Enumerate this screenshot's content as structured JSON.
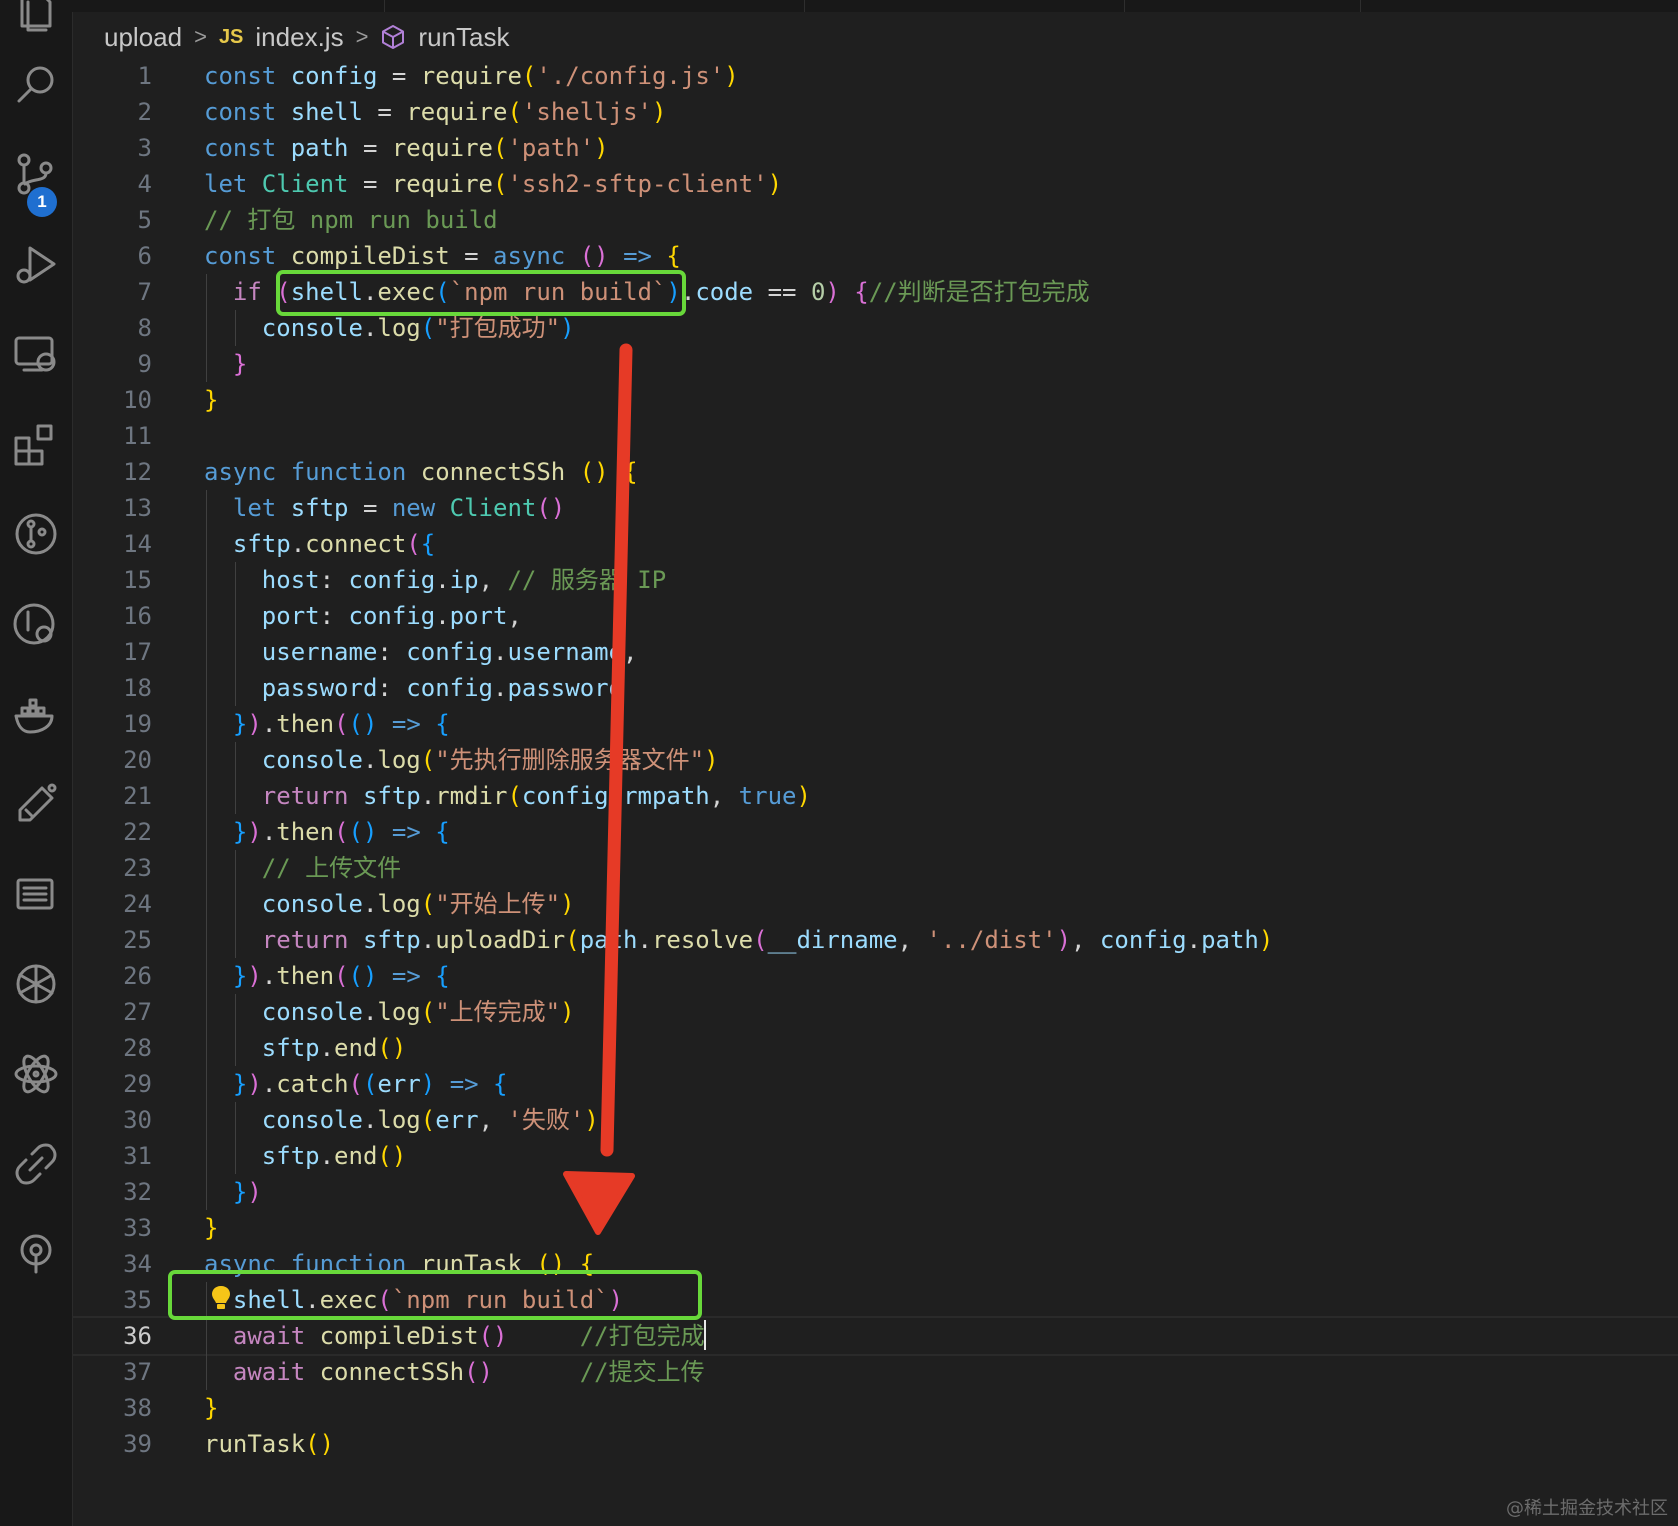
{
  "breadcrumb": {
    "folder": "upload",
    "file_badge": "JS",
    "file": "index.js",
    "symbol": "runTask"
  },
  "activity_bar": {
    "source_control_badge": "1",
    "icons": [
      "files-icon",
      "search-icon",
      "source-control-icon",
      "run-debug-icon",
      "remote-explorer-icon",
      "extensions-icon",
      "git-graph-icon",
      "git-history-icon",
      "docker-icon",
      "testing-icon",
      "outline-icon",
      "chatgpt-icon",
      "react-icon",
      "link-icon",
      "gitlens-icon"
    ]
  },
  "editor": {
    "active_line": 36,
    "lines": [
      {
        "n": "1",
        "t": [
          [
            "kw",
            "const "
          ],
          [
            "var",
            "config "
          ],
          [
            "op",
            "= "
          ],
          [
            "fn",
            "require"
          ],
          [
            "b1",
            "("
          ],
          [
            "str",
            "'./config.js'"
          ],
          [
            "b1",
            ")"
          ]
        ]
      },
      {
        "n": "2",
        "t": [
          [
            "kw",
            "const "
          ],
          [
            "var",
            "shell "
          ],
          [
            "op",
            "= "
          ],
          [
            "fn",
            "require"
          ],
          [
            "b1",
            "("
          ],
          [
            "str",
            "'shelljs'"
          ],
          [
            "b1",
            ")"
          ]
        ]
      },
      {
        "n": "3",
        "t": [
          [
            "kw",
            "const "
          ],
          [
            "var",
            "path "
          ],
          [
            "op",
            "= "
          ],
          [
            "fn",
            "require"
          ],
          [
            "b1",
            "("
          ],
          [
            "str",
            "'path'"
          ],
          [
            "b1",
            ")"
          ]
        ]
      },
      {
        "n": "4",
        "t": [
          [
            "kw",
            "let "
          ],
          [
            "cls",
            "Client "
          ],
          [
            "op",
            "= "
          ],
          [
            "fn",
            "require"
          ],
          [
            "b1",
            "("
          ],
          [
            "str",
            "'ssh2-sftp-client'"
          ],
          [
            "b1",
            ")"
          ]
        ]
      },
      {
        "n": "5",
        "t": [
          [
            "cmt",
            "// 打包 npm run build"
          ]
        ]
      },
      {
        "n": "6",
        "t": [
          [
            "kw",
            "const "
          ],
          [
            "fn",
            "compileDist "
          ],
          [
            "op",
            "= "
          ],
          [
            "kw",
            "async "
          ],
          [
            "b2",
            "() "
          ],
          [
            "kw",
            "=> "
          ],
          [
            "b1",
            "{"
          ]
        ]
      },
      {
        "n": "7",
        "t": [
          [
            "op",
            "  "
          ],
          [
            "ctrl",
            "if "
          ],
          [
            "b2",
            "("
          ],
          [
            "var",
            "shell"
          ],
          [
            "op",
            "."
          ],
          [
            "fn",
            "exec"
          ],
          [
            "b3",
            "("
          ],
          [
            "str",
            "`npm run build`"
          ],
          [
            "b3",
            ")"
          ],
          [
            "op",
            "."
          ],
          [
            "var",
            "code "
          ],
          [
            "op",
            "== "
          ],
          [
            "num",
            "0"
          ],
          [
            "b2",
            ") "
          ],
          [
            "b2",
            "{"
          ],
          [
            "cmt",
            "//判断是否打包完成"
          ]
        ]
      },
      {
        "n": "8",
        "t": [
          [
            "op",
            "    "
          ],
          [
            "var",
            "console"
          ],
          [
            "op",
            "."
          ],
          [
            "fn",
            "log"
          ],
          [
            "b3",
            "("
          ],
          [
            "str",
            "\"打包成功\""
          ],
          [
            "b3",
            ")"
          ]
        ]
      },
      {
        "n": "9",
        "t": [
          [
            "op",
            "  "
          ],
          [
            "b2",
            "}"
          ]
        ]
      },
      {
        "n": "10",
        "t": [
          [
            "b1",
            "}"
          ]
        ]
      },
      {
        "n": "11",
        "t": []
      },
      {
        "n": "12",
        "t": [
          [
            "kw",
            "async "
          ],
          [
            "kw",
            "function "
          ],
          [
            "fn",
            "connectSSh "
          ],
          [
            "b1",
            "() "
          ],
          [
            "b1",
            "{"
          ]
        ]
      },
      {
        "n": "13",
        "t": [
          [
            "op",
            "  "
          ],
          [
            "kw",
            "let "
          ],
          [
            "var",
            "sftp "
          ],
          [
            "op",
            "= "
          ],
          [
            "kw",
            "new "
          ],
          [
            "cls",
            "Client"
          ],
          [
            "b2",
            "()"
          ]
        ]
      },
      {
        "n": "14",
        "t": [
          [
            "op",
            "  "
          ],
          [
            "var",
            "sftp"
          ],
          [
            "op",
            "."
          ],
          [
            "fn",
            "connect"
          ],
          [
            "b2",
            "("
          ],
          [
            "b3",
            "{"
          ]
        ]
      },
      {
        "n": "15",
        "t": [
          [
            "op",
            "    "
          ],
          [
            "var",
            "host"
          ],
          [
            "op",
            ": "
          ],
          [
            "var",
            "config"
          ],
          [
            "op",
            "."
          ],
          [
            "var",
            "ip"
          ],
          [
            "op",
            ", "
          ],
          [
            "cmt",
            "// 服务器 IP"
          ]
        ]
      },
      {
        "n": "16",
        "t": [
          [
            "op",
            "    "
          ],
          [
            "var",
            "port"
          ],
          [
            "op",
            ": "
          ],
          [
            "var",
            "config"
          ],
          [
            "op",
            "."
          ],
          [
            "var",
            "port"
          ],
          [
            "op",
            ","
          ]
        ]
      },
      {
        "n": "17",
        "t": [
          [
            "op",
            "    "
          ],
          [
            "var",
            "username"
          ],
          [
            "op",
            ": "
          ],
          [
            "var",
            "config"
          ],
          [
            "op",
            "."
          ],
          [
            "var",
            "username"
          ],
          [
            "op",
            ","
          ]
        ]
      },
      {
        "n": "18",
        "t": [
          [
            "op",
            "    "
          ],
          [
            "var",
            "password"
          ],
          [
            "op",
            ": "
          ],
          [
            "var",
            "config"
          ],
          [
            "op",
            "."
          ],
          [
            "var",
            "password"
          ]
        ]
      },
      {
        "n": "19",
        "t": [
          [
            "op",
            "  "
          ],
          [
            "b3",
            "}"
          ],
          [
            "b2",
            ")"
          ],
          [
            "op",
            "."
          ],
          [
            "fn",
            "then"
          ],
          [
            "b2",
            "("
          ],
          [
            "b3",
            "() "
          ],
          [
            "kw",
            "=> "
          ],
          [
            "b3",
            "{"
          ]
        ]
      },
      {
        "n": "20",
        "t": [
          [
            "op",
            "    "
          ],
          [
            "var",
            "console"
          ],
          [
            "op",
            "."
          ],
          [
            "fn",
            "log"
          ],
          [
            "b1",
            "("
          ],
          [
            "str",
            "\"先执行删除服务器文件\""
          ],
          [
            "b1",
            ")"
          ]
        ]
      },
      {
        "n": "21",
        "t": [
          [
            "op",
            "    "
          ],
          [
            "ctrl",
            "return "
          ],
          [
            "var",
            "sftp"
          ],
          [
            "op",
            "."
          ],
          [
            "fn",
            "rmdir"
          ],
          [
            "b1",
            "("
          ],
          [
            "var",
            "config"
          ],
          [
            "op",
            "."
          ],
          [
            "var",
            "rmpath"
          ],
          [
            "op",
            ", "
          ],
          [
            "kw",
            "true"
          ],
          [
            "b1",
            ")"
          ]
        ]
      },
      {
        "n": "22",
        "t": [
          [
            "op",
            "  "
          ],
          [
            "b3",
            "}"
          ],
          [
            "b2",
            ")"
          ],
          [
            "op",
            "."
          ],
          [
            "fn",
            "then"
          ],
          [
            "b2",
            "("
          ],
          [
            "b3",
            "() "
          ],
          [
            "kw",
            "=> "
          ],
          [
            "b3",
            "{"
          ]
        ]
      },
      {
        "n": "23",
        "t": [
          [
            "op",
            "    "
          ],
          [
            "cmt",
            "// 上传文件"
          ]
        ]
      },
      {
        "n": "24",
        "t": [
          [
            "op",
            "    "
          ],
          [
            "var",
            "console"
          ],
          [
            "op",
            "."
          ],
          [
            "fn",
            "log"
          ],
          [
            "b1",
            "("
          ],
          [
            "str",
            "\"开始上传\""
          ],
          [
            "b1",
            ")"
          ]
        ]
      },
      {
        "n": "25",
        "t": [
          [
            "op",
            "    "
          ],
          [
            "ctrl",
            "return "
          ],
          [
            "var",
            "sftp"
          ],
          [
            "op",
            "."
          ],
          [
            "fn",
            "uploadDir"
          ],
          [
            "b1",
            "("
          ],
          [
            "var",
            "path"
          ],
          [
            "op",
            "."
          ],
          [
            "fn",
            "resolve"
          ],
          [
            "b2",
            "("
          ],
          [
            "var",
            "__dirname"
          ],
          [
            "op",
            ", "
          ],
          [
            "str",
            "'../dist'"
          ],
          [
            "b2",
            ")"
          ],
          [
            "op",
            ", "
          ],
          [
            "var",
            "config"
          ],
          [
            "op",
            "."
          ],
          [
            "var",
            "path"
          ],
          [
            "b1",
            ")"
          ]
        ]
      },
      {
        "n": "26",
        "t": [
          [
            "op",
            "  "
          ],
          [
            "b3",
            "}"
          ],
          [
            "b2",
            ")"
          ],
          [
            "op",
            "."
          ],
          [
            "fn",
            "then"
          ],
          [
            "b2",
            "("
          ],
          [
            "b3",
            "() "
          ],
          [
            "kw",
            "=> "
          ],
          [
            "b3",
            "{"
          ]
        ]
      },
      {
        "n": "27",
        "t": [
          [
            "op",
            "    "
          ],
          [
            "var",
            "console"
          ],
          [
            "op",
            "."
          ],
          [
            "fn",
            "log"
          ],
          [
            "b1",
            "("
          ],
          [
            "str",
            "\"上传完成\""
          ],
          [
            "b1",
            ")"
          ]
        ]
      },
      {
        "n": "28",
        "t": [
          [
            "op",
            "    "
          ],
          [
            "var",
            "sftp"
          ],
          [
            "op",
            "."
          ],
          [
            "fn",
            "end"
          ],
          [
            "b1",
            "()"
          ]
        ]
      },
      {
        "n": "29",
        "t": [
          [
            "op",
            "  "
          ],
          [
            "b3",
            "}"
          ],
          [
            "b2",
            ")"
          ],
          [
            "op",
            "."
          ],
          [
            "fn",
            "catch"
          ],
          [
            "b2",
            "("
          ],
          [
            "b3",
            "("
          ],
          [
            "var",
            "err"
          ],
          [
            "b3",
            ") "
          ],
          [
            "kw",
            "=> "
          ],
          [
            "b3",
            "{"
          ]
        ]
      },
      {
        "n": "30",
        "t": [
          [
            "op",
            "    "
          ],
          [
            "var",
            "console"
          ],
          [
            "op",
            "."
          ],
          [
            "fn",
            "log"
          ],
          [
            "b1",
            "("
          ],
          [
            "var",
            "err"
          ],
          [
            "op",
            ", "
          ],
          [
            "str",
            "'失败'"
          ],
          [
            "b1",
            ")"
          ]
        ]
      },
      {
        "n": "31",
        "t": [
          [
            "op",
            "    "
          ],
          [
            "var",
            "sftp"
          ],
          [
            "op",
            "."
          ],
          [
            "fn",
            "end"
          ],
          [
            "b1",
            "()"
          ]
        ]
      },
      {
        "n": "32",
        "t": [
          [
            "op",
            "  "
          ],
          [
            "b3",
            "}"
          ],
          [
            "b2",
            ")"
          ]
        ]
      },
      {
        "n": "33",
        "t": [
          [
            "b1",
            "}"
          ]
        ]
      },
      {
        "n": "34",
        "t": [
          [
            "kw",
            "async "
          ],
          [
            "kw",
            "function "
          ],
          [
            "fn",
            "runTask "
          ],
          [
            "b1",
            "() "
          ],
          [
            "b1",
            "{"
          ]
        ]
      },
      {
        "n": "35",
        "t": [
          [
            "op",
            "  "
          ],
          [
            "var",
            "shell"
          ],
          [
            "op",
            "."
          ],
          [
            "fn",
            "exec"
          ],
          [
            "b2",
            "("
          ],
          [
            "str",
            "`npm run build`"
          ],
          [
            "b2",
            ")"
          ]
        ]
      },
      {
        "n": "36",
        "t": [
          [
            "op",
            "  "
          ],
          [
            "ctrl",
            "await "
          ],
          [
            "fn",
            "compileDist"
          ],
          [
            "b2",
            "()"
          ],
          [
            "op",
            "     "
          ],
          [
            "cmt",
            "//打包完成"
          ]
        ]
      },
      {
        "n": "37",
        "t": [
          [
            "op",
            "  "
          ],
          [
            "ctrl",
            "await "
          ],
          [
            "fn",
            "connectSSh"
          ],
          [
            "b2",
            "()"
          ],
          [
            "op",
            "      "
          ],
          [
            "cmt",
            "//提交上传"
          ]
        ]
      },
      {
        "n": "38",
        "t": [
          [
            "b1",
            "}"
          ]
        ]
      },
      {
        "n": "39",
        "t": [
          [
            "fn",
            "runTask"
          ],
          [
            "b1",
            "()"
          ]
        ]
      }
    ]
  },
  "annotations": {
    "box_color": "#68d83a",
    "arrow_color": "#e63a26"
  },
  "watermark": "@稀土掘金技术社区"
}
